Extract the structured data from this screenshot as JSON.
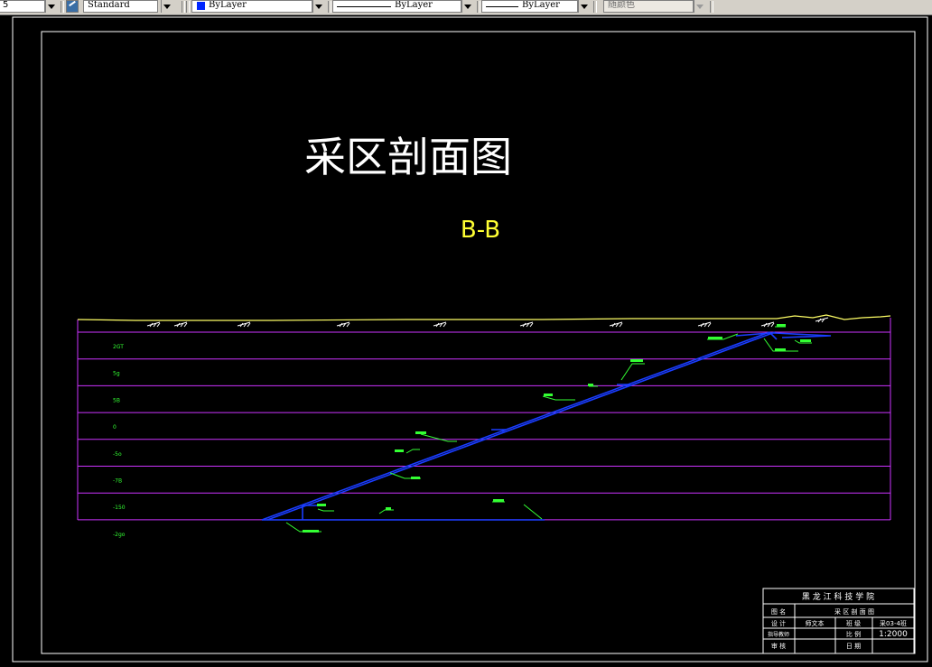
{
  "toolbar": {
    "layer_combo_value": "5",
    "textstyle_value": "Standard",
    "color_value": "ByLayer",
    "linetype_value": "ByLayer",
    "lineweight_value": "ByLayer",
    "plotstyle_value": "随颜色",
    "colors": {
      "bylayer_swatch": "#0026ff"
    }
  },
  "drawing": {
    "title": "采区剖面图",
    "section_label": "B-B",
    "elevation_labels": [
      "2GT",
      "5g",
      "5B",
      "0",
      "-5o",
      "-7B",
      "-150",
      "-2go"
    ],
    "colors": {
      "background": "#000000",
      "border": "#ffffff",
      "grid_lines": "#cc33ff",
      "surface": "#ffff66",
      "roadway": "#1a3dff",
      "annotations": "#33ff33",
      "section_label": "#ffff33"
    }
  },
  "title_block": {
    "school": "黑 龙 江 科 技 学 院",
    "row1_label": "图 名",
    "row1_value": "采 区 剖 面 图",
    "row2_cells": [
      "设  计",
      "师文本",
      "班  级",
      "采03-4班"
    ],
    "row3_cells": [
      "指导教师",
      "",
      "比  例",
      "1:2000"
    ],
    "row4_cells": [
      "审  核",
      "",
      "日  期",
      ""
    ]
  }
}
